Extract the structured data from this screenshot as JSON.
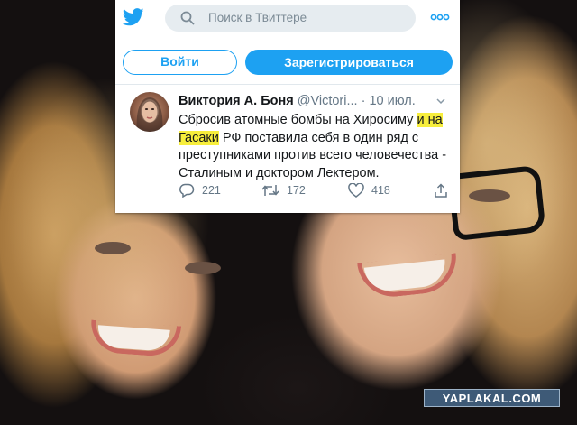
{
  "header": {
    "search_placeholder": "Поиск в Твиттере",
    "icons": {
      "logo": "twitter-bird-icon",
      "search": "search-icon",
      "more": "more-dots-icon"
    }
  },
  "buttons": {
    "login_label": "Войти",
    "signup_label": "Зарегистрироваться"
  },
  "tweet": {
    "author_name": "Виктория А. Боня",
    "author_handle": "@Victori...",
    "date": "· 10 июл.",
    "text_parts": {
      "p1": "Сбросив атомные бомбы на Хиросиму ",
      "highlight1": "и на",
      "highlight2": "Гасаки",
      "p2": " РФ поставила себя в один ряд с преступниками против всего человечества - Сталиным и доктором Лектером."
    },
    "stats": {
      "replies": "221",
      "retweets": "172",
      "likes": "418"
    }
  },
  "colors": {
    "brand": "#1da1f2",
    "highlight": "#f7ee3c",
    "muted": "#657786"
  },
  "watermark": "YAPLAKAL.COM"
}
